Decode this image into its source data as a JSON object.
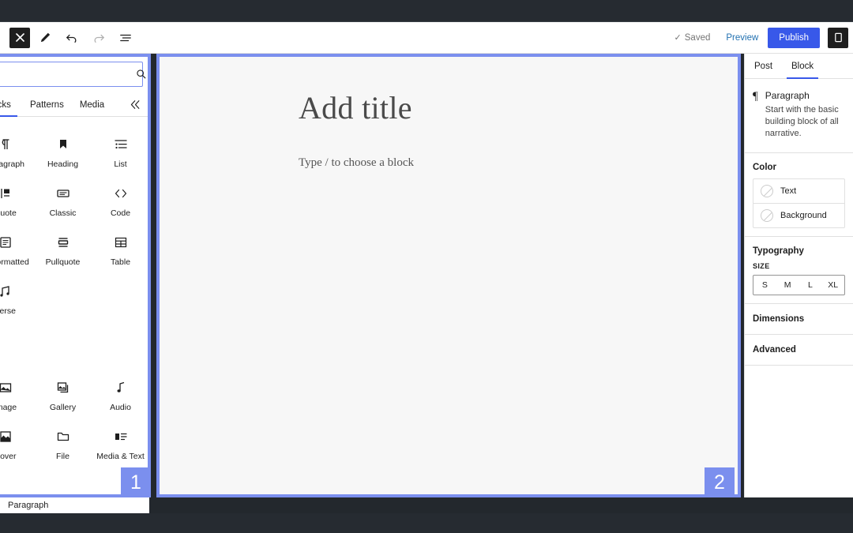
{
  "toolbar": {
    "inserter_icon": "close-x-icon",
    "tools": [
      {
        "name": "edit-pencil-icon",
        "label": "Tools"
      },
      {
        "name": "undo-icon",
        "label": "Undo"
      },
      {
        "name": "redo-icon",
        "label": "Redo"
      },
      {
        "name": "list-view-icon",
        "label": "Document overview"
      }
    ],
    "saved_label": "Saved",
    "saved_check": "✓",
    "preview_label": "Preview",
    "publish_label": "Publish",
    "settings_icon": "settings-gear-icon",
    "publish_color": "#3858e9",
    "preview_color": "#2271b1"
  },
  "inserter": {
    "search": {
      "value": "",
      "placeholder": ""
    },
    "search_icon": "search-icon",
    "tabs": [
      {
        "label": "Blocks",
        "active": true
      },
      {
        "label": "Patterns",
        "active": false
      },
      {
        "label": "Media",
        "active": false
      }
    ],
    "collapse_icon": "chevron-double-left-icon",
    "blocks": [
      {
        "label": "Paragraph",
        "icon": "paragraph-icon"
      },
      {
        "label": "Heading",
        "icon": "heading-bookmark-icon"
      },
      {
        "label": "List",
        "icon": "list-icon"
      },
      {
        "label": "Quote",
        "icon": "quote-icon"
      },
      {
        "label": "Classic",
        "icon": "classic-icon"
      },
      {
        "label": "Code",
        "icon": "code-brackets-icon"
      },
      {
        "label": "Preformatted",
        "icon": "preformatted-icon"
      },
      {
        "label": "Pullquote",
        "icon": "pullquote-icon"
      },
      {
        "label": "Table",
        "icon": "table-icon"
      },
      {
        "label": "Verse",
        "icon": "verse-icon"
      },
      {
        "label": "",
        "icon": ""
      },
      {
        "label": "",
        "icon": ""
      },
      {
        "label": "Image",
        "icon": "image-icon"
      },
      {
        "label": "Gallery",
        "icon": "gallery-icon"
      },
      {
        "label": "Audio",
        "icon": "audio-note-icon"
      },
      {
        "label": "Cover",
        "icon": "cover-icon"
      },
      {
        "label": "File",
        "icon": "file-folder-icon"
      },
      {
        "label": "Media & Text",
        "icon": "media-text-icon"
      }
    ]
  },
  "canvas": {
    "title_placeholder": "Add title",
    "body_placeholder": "Type / to choose a block"
  },
  "settings": {
    "tabs": [
      {
        "label": "Post",
        "active": false
      },
      {
        "label": "Block",
        "active": true
      }
    ],
    "block": {
      "icon": "pilcrow-icon",
      "glyph": "¶",
      "name": "Paragraph",
      "description": "Start with the basic building block of all narrative."
    },
    "color": {
      "title": "Color",
      "rows": [
        {
          "label": "Text",
          "swatch": "none"
        },
        {
          "label": "Background",
          "swatch": "none"
        }
      ]
    },
    "typography": {
      "title": "Typography",
      "size_label": "SIZE",
      "sizes": [
        "S",
        "M",
        "L",
        "XL"
      ]
    },
    "dimensions": {
      "title": "Dimensions"
    },
    "advanced": {
      "title": "Advanced"
    }
  },
  "status_bar": {
    "breadcrumb": "Paragraph"
  },
  "annotations": {
    "highlight_color": "#7b8fee",
    "badges": [
      {
        "number": "1",
        "target": "block-inserter-panel"
      },
      {
        "number": "2",
        "target": "editor-canvas"
      }
    ]
  }
}
